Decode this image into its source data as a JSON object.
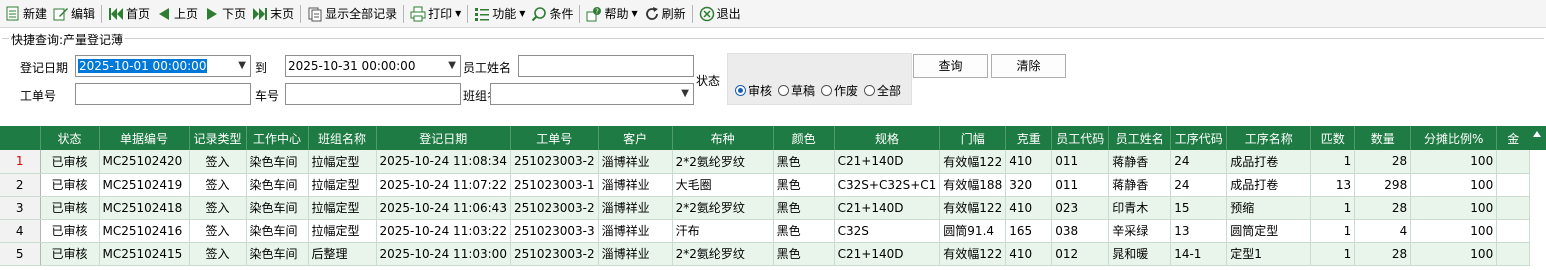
{
  "toolbar": {
    "new_label": "新建",
    "edit_label": "编辑",
    "first_label": "首页",
    "prev_label": "上页",
    "next_label": "下页",
    "last_label": "末页",
    "show_all_label": "显示全部记录",
    "print_label": "打印",
    "function_label": "功能",
    "condition_label": "条件",
    "help_label": "帮助",
    "refresh_label": "刷新",
    "exit_label": "退出"
  },
  "quick_search": {
    "title": "快捷查询:产量登记薄",
    "date_label": "登记日期",
    "date_from": "2025-10-01 00:00:00",
    "to_label": "到",
    "date_to": "2025-10-31 00:00:00",
    "employee_label": "员工姓名",
    "employee_value": "",
    "state_label": "状态",
    "order_label": "工单号",
    "order_value": "",
    "car_label": "车号",
    "car_value": "",
    "team_label": "班组名称",
    "team_value": "",
    "radios": [
      "审核",
      "草稿",
      "作废",
      "全部"
    ],
    "radio_selected": "审核",
    "query_button": "查询",
    "clear_button": "清除"
  },
  "grid": {
    "columns": [
      "",
      "状态",
      "单据编号",
      "记录类型",
      "工作中心",
      "班组名称",
      "登记日期",
      "工单号",
      "客户",
      "布种",
      "颜色",
      "规格",
      "门幅",
      "克重",
      "员工代码",
      "员工姓名",
      "工序代码",
      "工序名称",
      "匹数",
      "数量",
      "分摊比例%",
      "金"
    ],
    "rows": [
      [
        "1",
        "已审核",
        "MC25102420",
        "签入",
        "染色车间",
        "拉幅定型",
        "2025-10-24 11:08:34",
        "251023003-2",
        "淄博祥业",
        "2*2氨纶罗纹",
        "黑色",
        "C21+140D",
        "有效幅122",
        "410",
        "011",
        "蒋静香",
        "24",
        "成品打卷",
        "1",
        "28",
        "100",
        ""
      ],
      [
        "2",
        "已审核",
        "MC25102419",
        "签入",
        "染色车间",
        "拉幅定型",
        "2025-10-24 11:07:22",
        "251023003-1",
        "淄博祥业",
        "大毛圈",
        "黑色",
        "C32S+C32S+C1",
        "有效幅188",
        "320",
        "011",
        "蒋静香",
        "24",
        "成品打卷",
        "13",
        "298",
        "100",
        ""
      ],
      [
        "3",
        "已审核",
        "MC25102418",
        "签入",
        "染色车间",
        "拉幅定型",
        "2025-10-24 11:06:43",
        "251023003-2",
        "淄博祥业",
        "2*2氨纶罗纹",
        "黑色",
        "C21+140D",
        "有效幅122",
        "410",
        "023",
        "印青木",
        "15",
        "预缩",
        "1",
        "28",
        "100",
        ""
      ],
      [
        "4",
        "已审核",
        "MC25102416",
        "签入",
        "染色车间",
        "拉幅定型",
        "2025-10-24 11:03:22",
        "251023003-3",
        "淄博祥业",
        "汗布",
        "黑色",
        "C32S",
        "圆筒91.4",
        "165",
        "038",
        "辛采绿",
        "13",
        "圆筒定型",
        "1",
        "4",
        "100",
        ""
      ],
      [
        "5",
        "已审核",
        "MC25102415",
        "签入",
        "染色车间",
        "后整理",
        "2025-10-24 11:03:00",
        "251023003-2",
        "淄博祥业",
        "2*2氨纶罗纹",
        "黑色",
        "C21+140D",
        "有效幅122",
        "410",
        "012",
        "晁和暖",
        "14-1",
        "定型1",
        "1",
        "28",
        "100",
        ""
      ]
    ]
  }
}
